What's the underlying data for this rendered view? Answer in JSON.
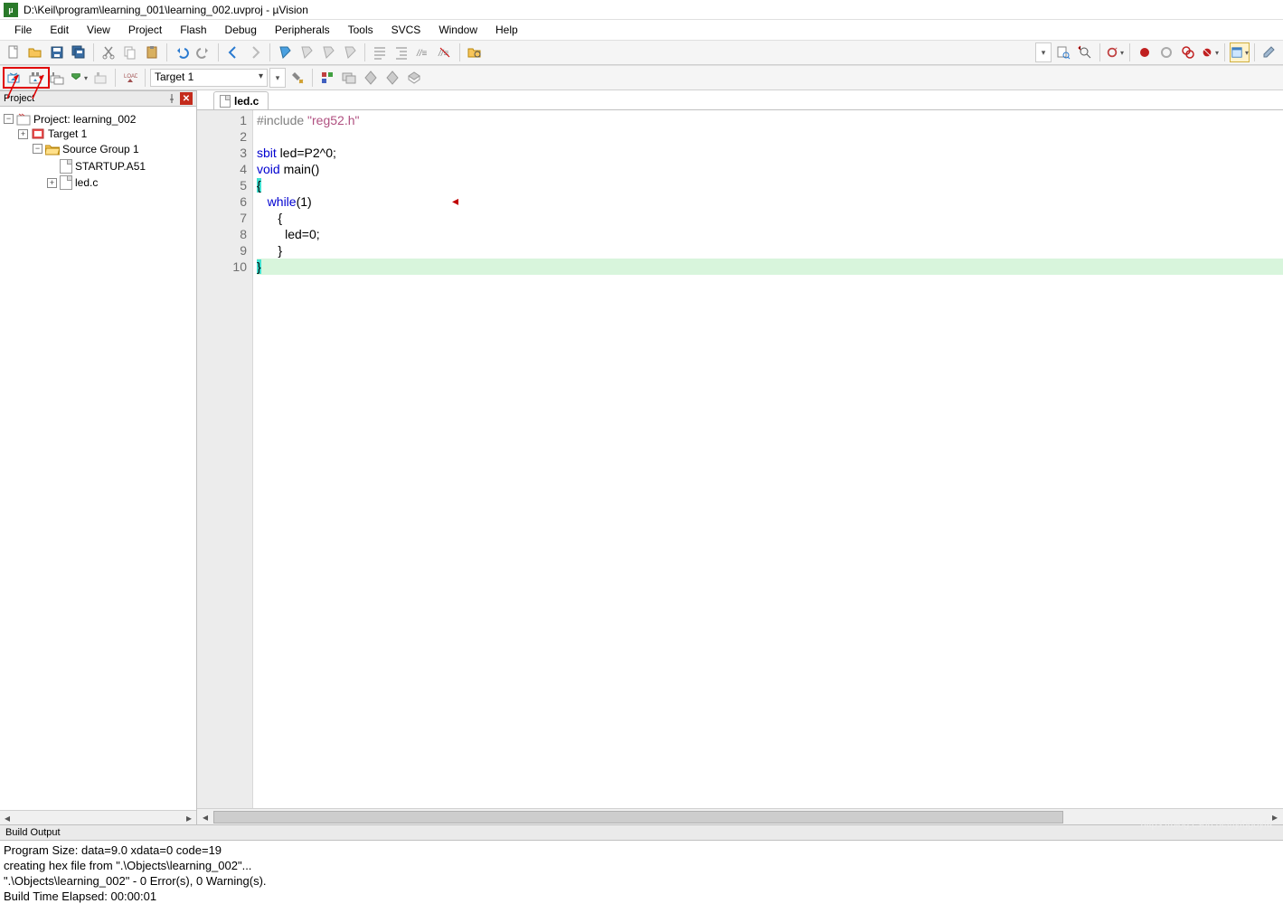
{
  "title": "D:\\Keil\\program\\learning_001\\learning_002.uvproj - µVision",
  "menus": [
    "File",
    "Edit",
    "View",
    "Project",
    "Flash",
    "Debug",
    "Peripherals",
    "Tools",
    "SVCS",
    "Window",
    "Help"
  ],
  "toolbar2": {
    "target": "Target 1"
  },
  "panels": {
    "project_title": "Project",
    "build_output_title": "Build Output"
  },
  "tree": {
    "root": "Project: learning_002",
    "target": "Target 1",
    "group": "Source Group 1",
    "files": [
      "STARTUP.A51",
      "led.c"
    ]
  },
  "editor": {
    "tab": "led.c",
    "lines": [
      {
        "n": 1,
        "segs": [
          {
            "t": "#include ",
            "c": "pp"
          },
          {
            "t": "\"reg52.h\"",
            "c": "str"
          }
        ]
      },
      {
        "n": 2,
        "segs": []
      },
      {
        "n": 3,
        "segs": [
          {
            "t": "sbit",
            "c": "kw"
          },
          {
            "t": " led=P2^0;",
            "c": ""
          }
        ]
      },
      {
        "n": 4,
        "segs": [
          {
            "t": "void",
            "c": "kw"
          },
          {
            "t": " main()",
            "c": ""
          }
        ]
      },
      {
        "n": 5,
        "segs": [
          {
            "t": "{",
            "c": "hl-brace"
          }
        ]
      },
      {
        "n": 6,
        "segs": [
          {
            "t": "   ",
            "c": ""
          },
          {
            "t": "while",
            "c": "kw"
          },
          {
            "t": "(1)",
            "c": ""
          }
        ]
      },
      {
        "n": 7,
        "segs": [
          {
            "t": "      {",
            "c": ""
          }
        ]
      },
      {
        "n": 8,
        "segs": [
          {
            "t": "        led=0;",
            "c": ""
          }
        ]
      },
      {
        "n": 9,
        "segs": [
          {
            "t": "      }",
            "c": ""
          }
        ]
      },
      {
        "n": 10,
        "segs": [
          {
            "t": "}",
            "c": "hl-brace"
          }
        ],
        "hl": true
      }
    ]
  },
  "output_lines": [
    "Program Size: data=9.0 xdata=0 code=19",
    "creating hex file from \".\\Objects\\learning_002\"...",
    "\".\\Objects\\learning_002\" - 0 Error(s), 0 Warning(s).",
    "Build Time Elapsed:  00:00:01"
  ],
  "watermark": "https://blog.csdn.net/lyfugoyfa"
}
